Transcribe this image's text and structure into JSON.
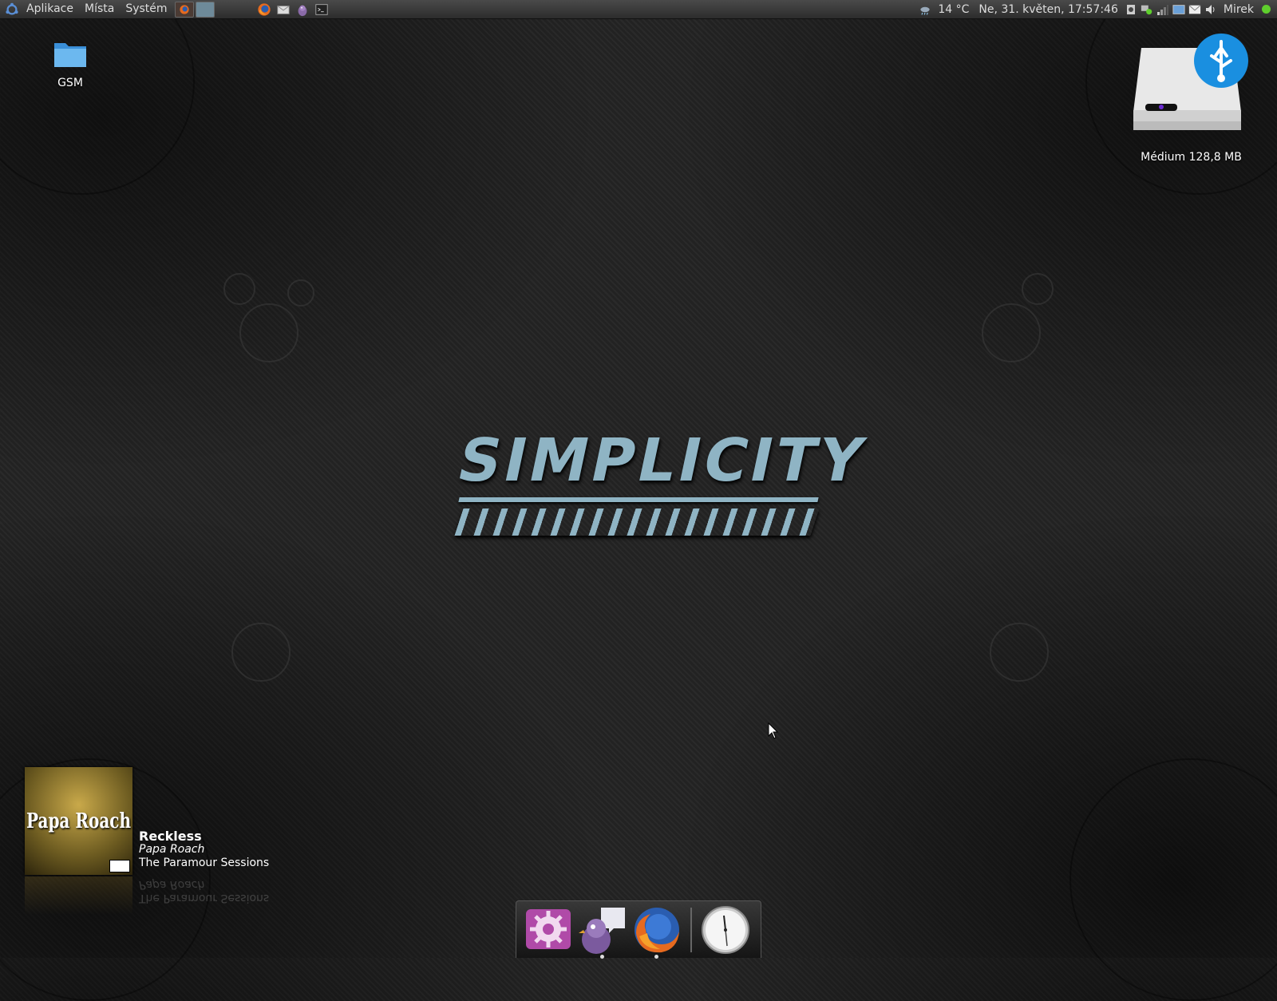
{
  "top_panel": {
    "menus": [
      "Aplikace",
      "Místa",
      "Systém"
    ],
    "weather": "14 °C",
    "datetime": "Ne, 31. květen, 17:57:46",
    "user": "Mirek"
  },
  "desktop": {
    "folder_label": "GSM",
    "drive_label": "Médium 128,8 MB"
  },
  "logo_text": "SIMPLICITY",
  "now_playing": {
    "title": "Reckless",
    "artist": "Papa Roach",
    "album": "The Paramour Sessions",
    "cover_text": "Papa Roach"
  },
  "colors": {
    "panel": "#3a3a3a",
    "logo": "#8fb4c4",
    "online": "#5fcf2d"
  }
}
